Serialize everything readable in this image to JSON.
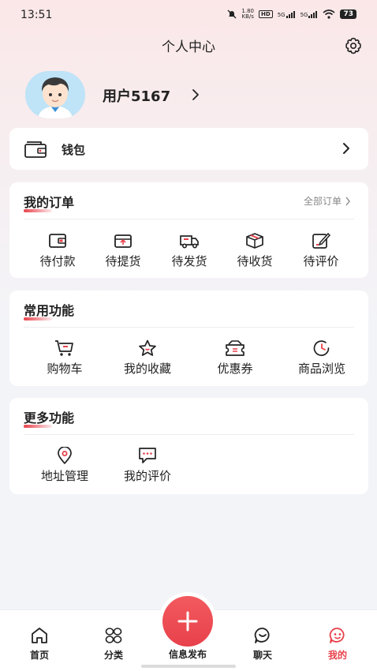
{
  "status_bar": {
    "time": "13:51",
    "network_speed_top": "1.80",
    "network_speed_bottom": "KB/s",
    "hd_label": "HD",
    "signal_1": "5G",
    "signal_2": "5G",
    "battery": "73",
    "icons": [
      "mute-icon",
      "hd-icon",
      "signal-icon",
      "signal-icon",
      "wifi-icon",
      "battery-icon"
    ]
  },
  "header": {
    "title": "个人中心",
    "settings_icon": "gear-icon"
  },
  "profile": {
    "username": "用户5167",
    "avatar_icon": "avatar-boy"
  },
  "wallet": {
    "label": "钱包",
    "icon": "wallet-icon"
  },
  "orders": {
    "title": "我的订单",
    "all_label": "全部订单",
    "items": [
      {
        "label": "待付款",
        "icon": "wallet-pay-icon"
      },
      {
        "label": "待提货",
        "icon": "pickup-icon"
      },
      {
        "label": "待发货",
        "icon": "truck-icon"
      },
      {
        "label": "待收货",
        "icon": "package-icon"
      },
      {
        "label": "待评价",
        "icon": "edit-review-icon"
      }
    ]
  },
  "common_functions": {
    "title": "常用功能",
    "items": [
      {
        "label": "购物车",
        "icon": "cart-icon"
      },
      {
        "label": "我的收藏",
        "icon": "star-icon"
      },
      {
        "label": "优惠券",
        "icon": "coupon-icon"
      },
      {
        "label": "商品浏览",
        "icon": "clock-icon"
      }
    ]
  },
  "more_functions": {
    "title": "更多功能",
    "items": [
      {
        "label": "地址管理",
        "icon": "location-pin-icon"
      },
      {
        "label": "我的评价",
        "icon": "chat-bubble-icon"
      }
    ]
  },
  "bottom_nav": {
    "items": [
      {
        "label": "首页",
        "icon": "home-icon"
      },
      {
        "label": "分类",
        "icon": "category-icon"
      },
      {
        "label": "信息发布",
        "icon": "plus-icon"
      },
      {
        "label": "聊天",
        "icon": "chat-face-icon"
      },
      {
        "label": "我的",
        "icon": "profile-face-icon",
        "active": true
      }
    ]
  },
  "colors": {
    "accent": "#e8414b",
    "text": "#222222",
    "muted": "#888888",
    "card": "#ffffff",
    "background": "#f3f4f8"
  }
}
